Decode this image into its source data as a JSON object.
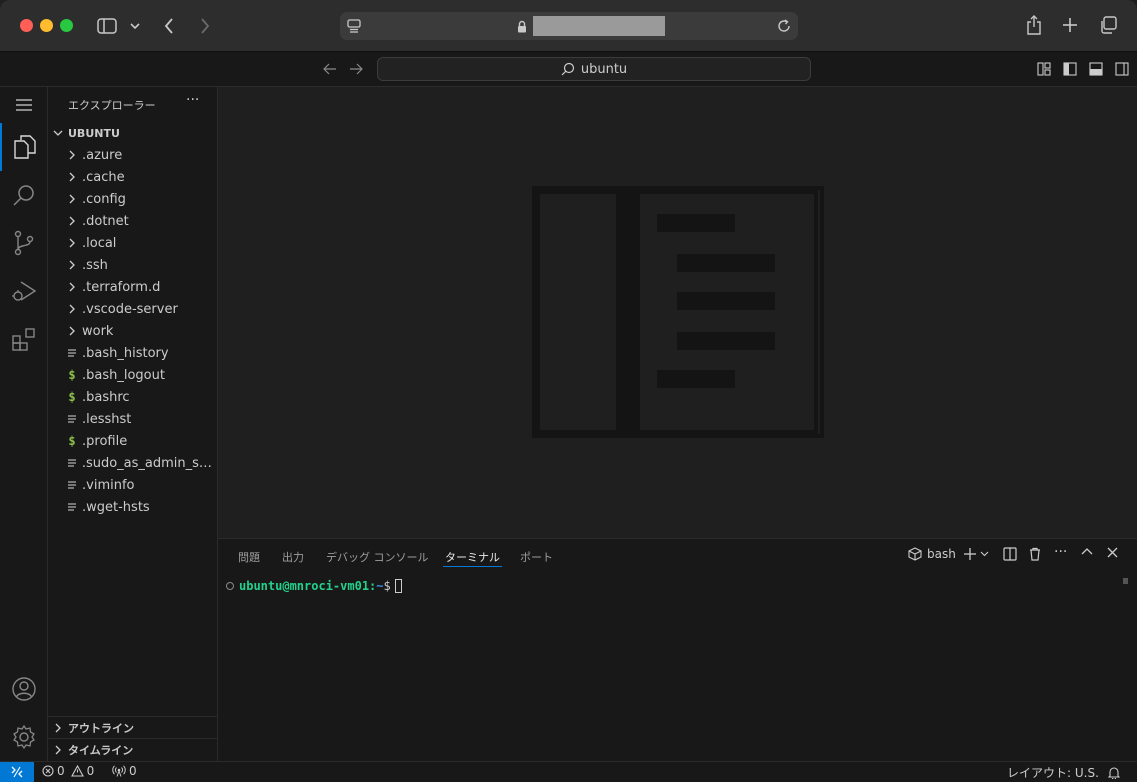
{
  "browser": {
    "address_masked": true
  },
  "titlebar": {
    "search_text": "ubuntu"
  },
  "sidebar": {
    "header": "エクスプローラー",
    "more": "···",
    "root": "UBUNTU",
    "items": [
      {
        "label": ".azure",
        "kind": "folder"
      },
      {
        "label": ".cache",
        "kind": "folder"
      },
      {
        "label": ".config",
        "kind": "folder"
      },
      {
        "label": ".dotnet",
        "kind": "folder"
      },
      {
        "label": ".local",
        "kind": "folder"
      },
      {
        "label": ".ssh",
        "kind": "folder"
      },
      {
        "label": ".terraform.d",
        "kind": "folder"
      },
      {
        "label": ".vscode-server",
        "kind": "folder"
      },
      {
        "label": "work",
        "kind": "folder"
      },
      {
        "label": ".bash_history",
        "kind": "text"
      },
      {
        "label": ".bash_logout",
        "kind": "shell"
      },
      {
        "label": ".bashrc",
        "kind": "shell"
      },
      {
        "label": ".lesshst",
        "kind": "text"
      },
      {
        "label": ".profile",
        "kind": "shell"
      },
      {
        "label": ".sudo_as_admin_su...",
        "kind": "text"
      },
      {
        "label": ".viminfo",
        "kind": "text"
      },
      {
        "label": ".wget-hsts",
        "kind": "text"
      }
    ],
    "outline": "アウトライン",
    "timeline": "タイムライン"
  },
  "panel": {
    "tabs": [
      "問題",
      "出力",
      "デバッグ コンソール",
      "ターミナル",
      "ポート"
    ],
    "active_tab": 3,
    "shell_name": "bash",
    "terminal": {
      "user_host": "ubuntu@mnroci-vm01",
      "sep": ":",
      "path": "~",
      "prompt": "$"
    }
  },
  "status": {
    "errors": "0",
    "warnings": "0",
    "ports": "0",
    "layout": "レイアウト: U.S."
  },
  "colors": {
    "accent": "#0078d4",
    "shell_icon": "#8dc149",
    "terminal_user": "#23d18b",
    "terminal_path": "#3b8eea"
  }
}
